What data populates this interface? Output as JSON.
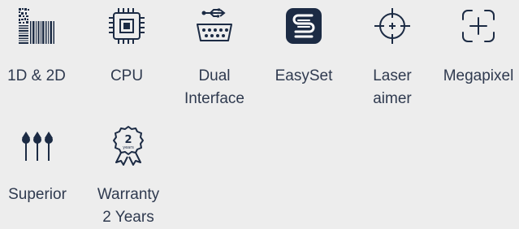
{
  "colors": {
    "background": "#ededed",
    "icon": "#1c2b44",
    "text": "#2f3a4f"
  },
  "features": [
    {
      "icon": "barcode-qr-icon",
      "label_lines": [
        "1D & 2D"
      ]
    },
    {
      "icon": "cpu-icon",
      "label_lines": [
        "CPU"
      ]
    },
    {
      "icon": "usb-serial-icon",
      "label_lines": [
        "Dual",
        "Interface"
      ]
    },
    {
      "icon": "easyset-logo-icon",
      "label_lines": [
        "EasySet"
      ]
    },
    {
      "icon": "laser-crosshair-icon",
      "label_lines": [
        "Laser",
        "aimer"
      ]
    },
    {
      "icon": "megapixel-viewfinder-icon",
      "label_lines": [
        "Megapixel"
      ]
    },
    {
      "icon": "pins-icon",
      "label_lines": [
        "Superior"
      ]
    },
    {
      "icon": "warranty-badge-icon",
      "badge_text": "2",
      "badge_subtext": "years",
      "label_lines": [
        "Warranty",
        "2 Years"
      ]
    }
  ]
}
